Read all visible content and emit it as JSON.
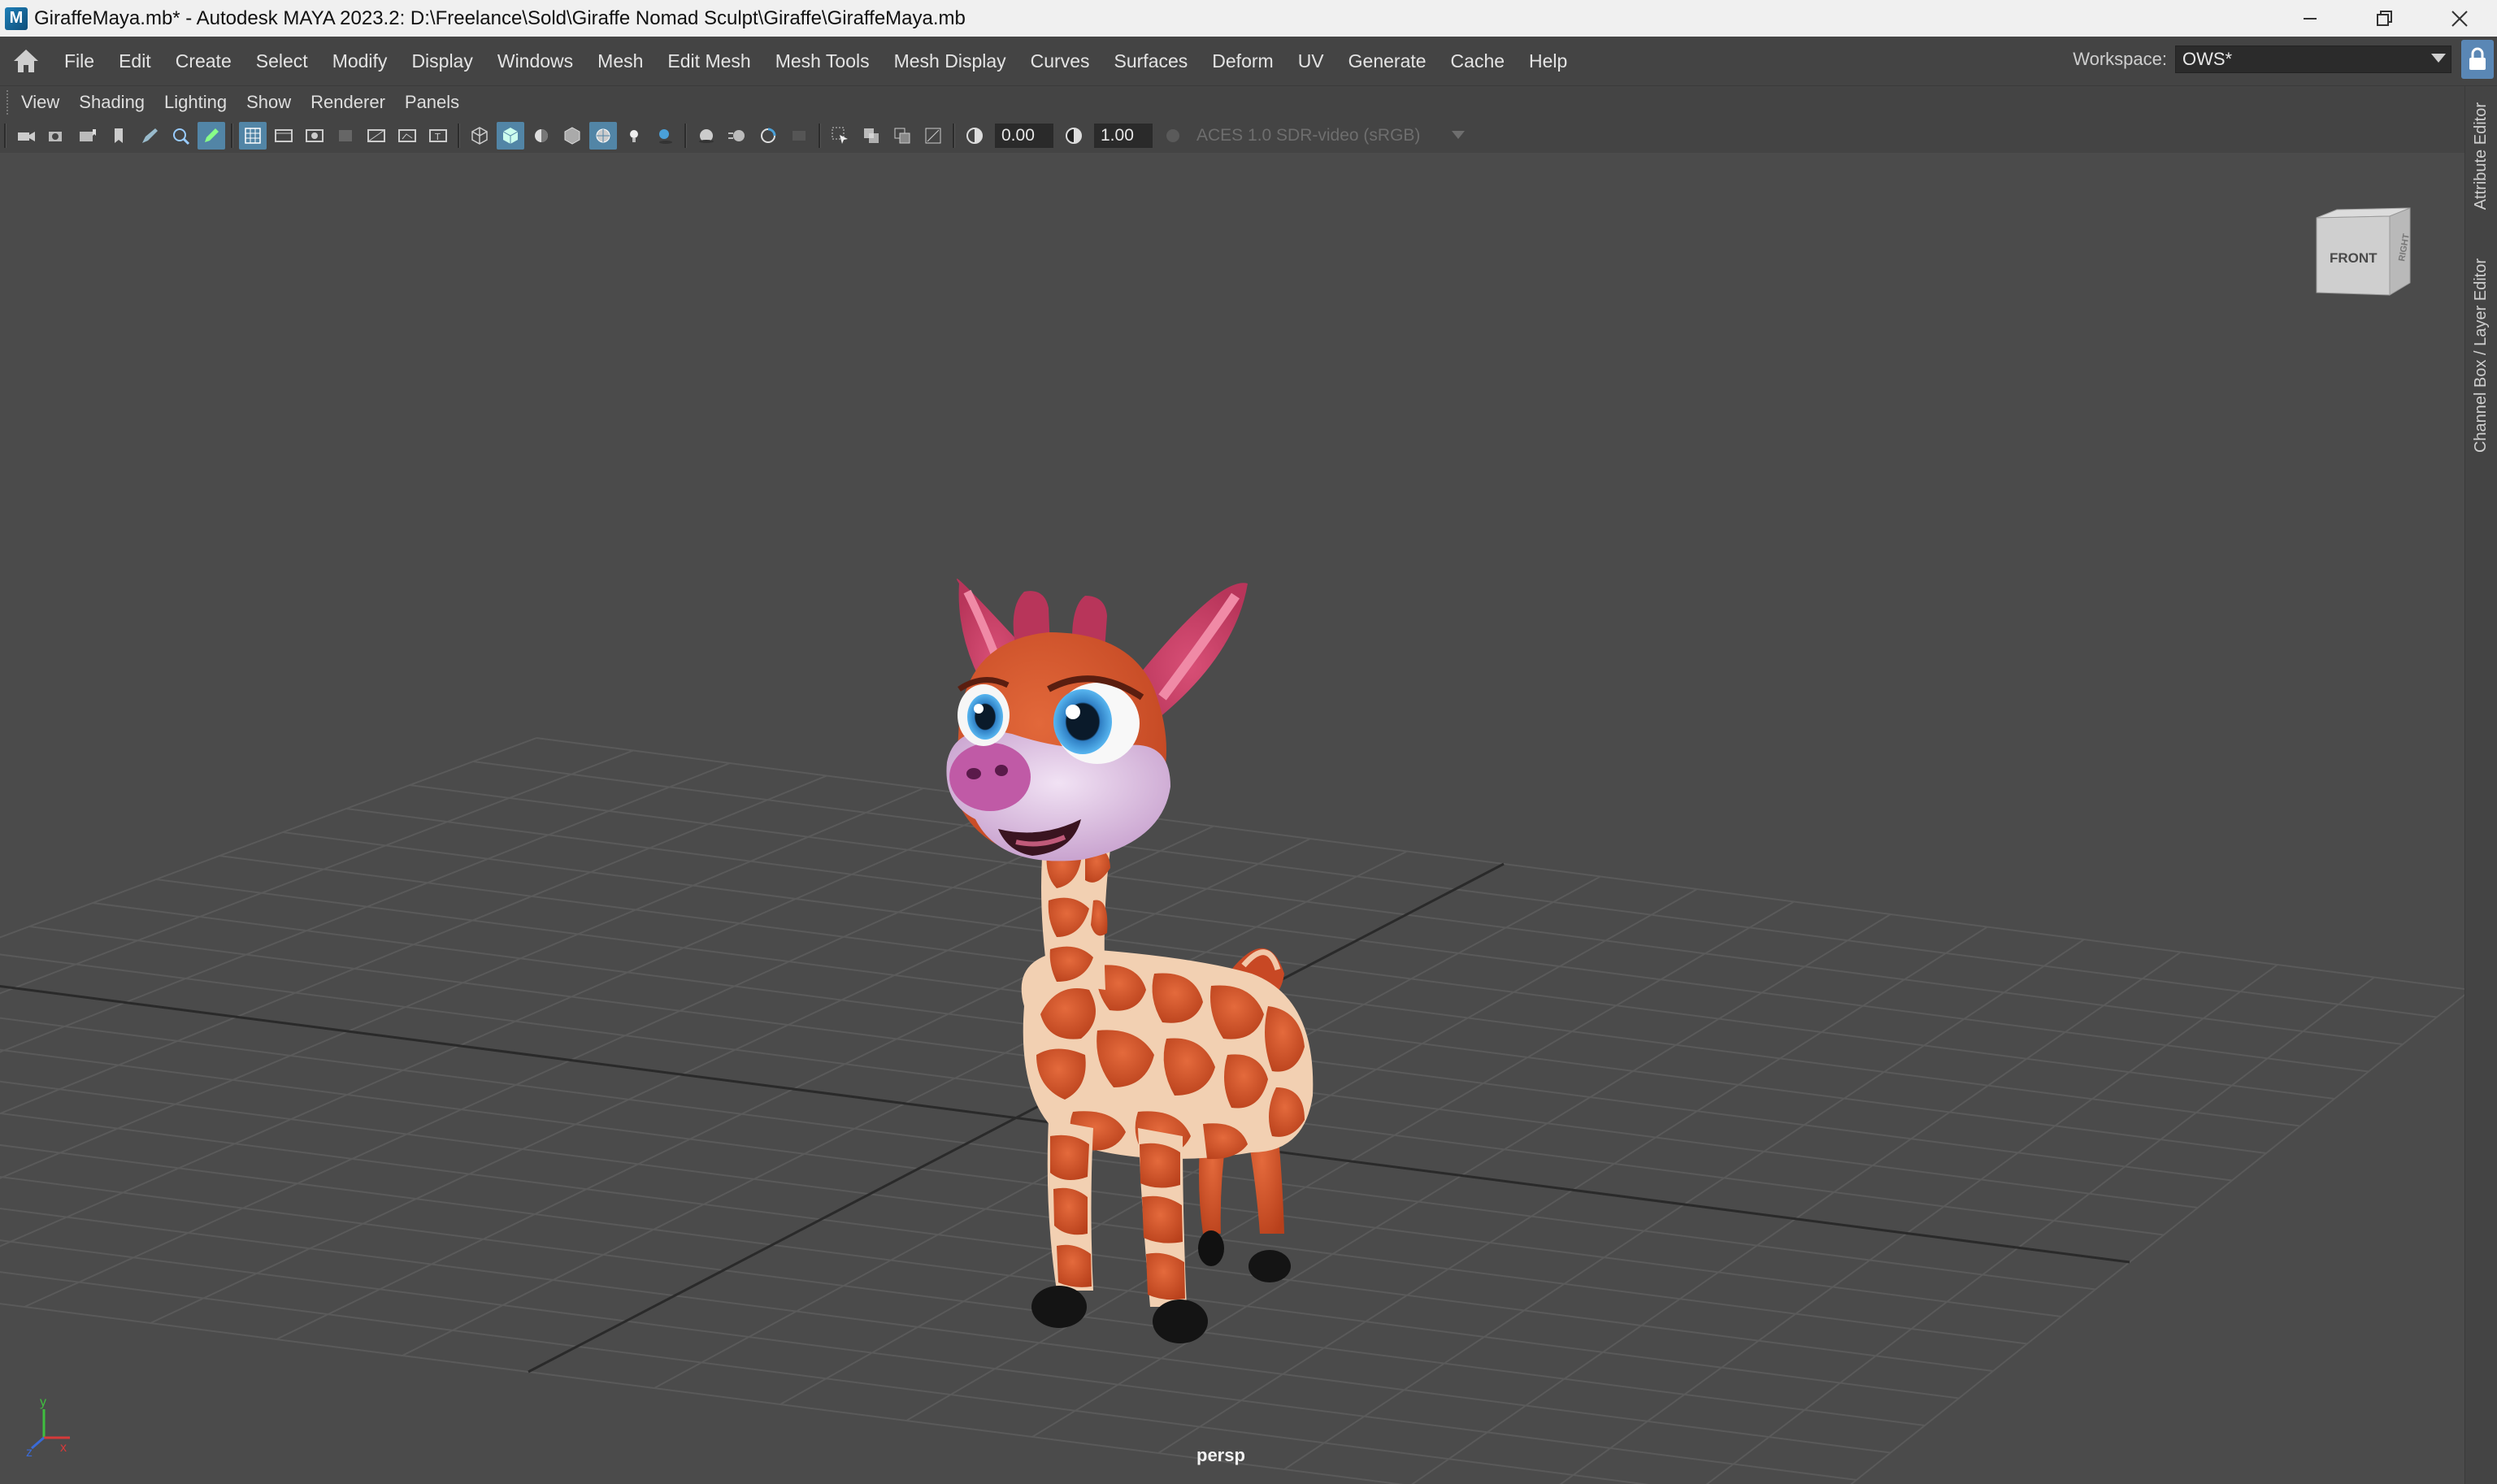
{
  "window": {
    "title": "GiraffeMaya.mb* - Autodesk MAYA 2023.2: D:\\Freelance\\Sold\\Giraffe Nomad Sculpt\\Giraffe\\GiraffeMaya.mb",
    "app_icon_letter": "M"
  },
  "menubar": {
    "items": [
      "File",
      "Edit",
      "Create",
      "Select",
      "Modify",
      "Display",
      "Windows",
      "Mesh",
      "Edit Mesh",
      "Mesh Tools",
      "Mesh Display",
      "Curves",
      "Surfaces",
      "Deform",
      "UV",
      "Generate",
      "Cache",
      "Help"
    ]
  },
  "workspace": {
    "label": "Workspace:",
    "value": "OWS*"
  },
  "panel_menu": {
    "items": [
      "View",
      "Shading",
      "Lighting",
      "Show",
      "Renderer",
      "Panels"
    ]
  },
  "toolbar": {
    "exposure": "0.00",
    "gamma": "1.00",
    "color_management": "ACES 1.0 SDR-video (sRGB)"
  },
  "viewport": {
    "camera": "persp",
    "view_cube_front": "FRONT",
    "view_cube_right": "RIGHT",
    "axis_x": "x",
    "axis_y": "y",
    "axis_z": "z",
    "accent_color": "#5285a6"
  },
  "right_strip": {
    "tab_attribute": "Attribute Editor",
    "tab_channel": "Channel Box / Layer Editor"
  }
}
